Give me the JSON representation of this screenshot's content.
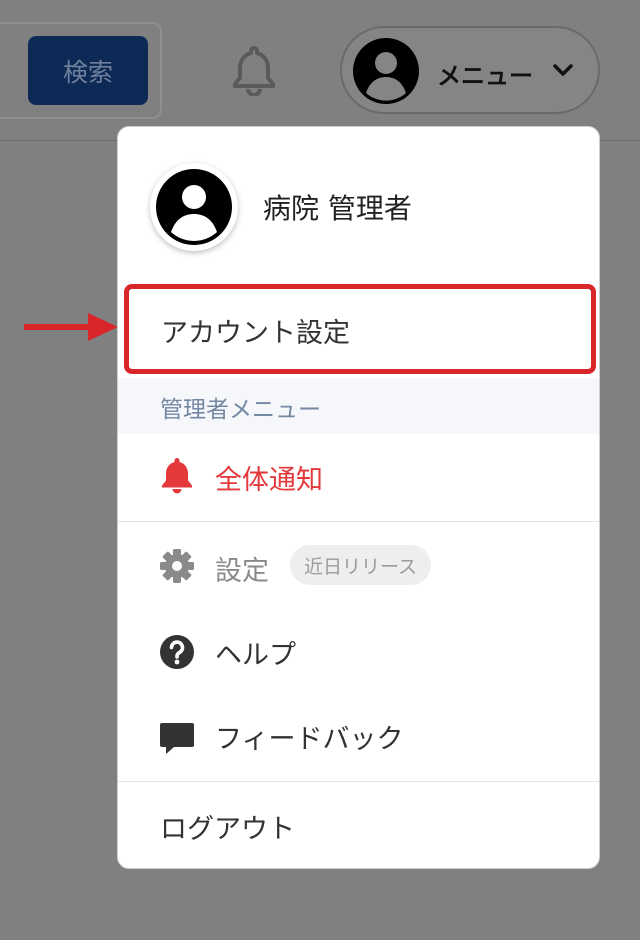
{
  "header": {
    "search_label": "検索",
    "menu_label": "メニュー"
  },
  "dropdown": {
    "user_name": "病院 管理者",
    "account_settings": "アカウント設定",
    "admin_section_label": "管理者メニュー",
    "items": [
      {
        "label": "全体通知",
        "icon": "bell-icon",
        "color": "#e5383b"
      },
      {
        "label": "設定",
        "icon": "gear-icon",
        "badge": "近日リリース",
        "color": "#8a8a8a"
      },
      {
        "label": "ヘルプ",
        "icon": "question-circle-icon",
        "color": "#333333"
      },
      {
        "label": "フィードバック",
        "icon": "comment-icon",
        "color": "#333333"
      }
    ],
    "logout": "ログアウト"
  },
  "colors": {
    "highlight_border": "#d9262a",
    "arrow": "#d9262a",
    "search_button": "#0d2a57"
  }
}
